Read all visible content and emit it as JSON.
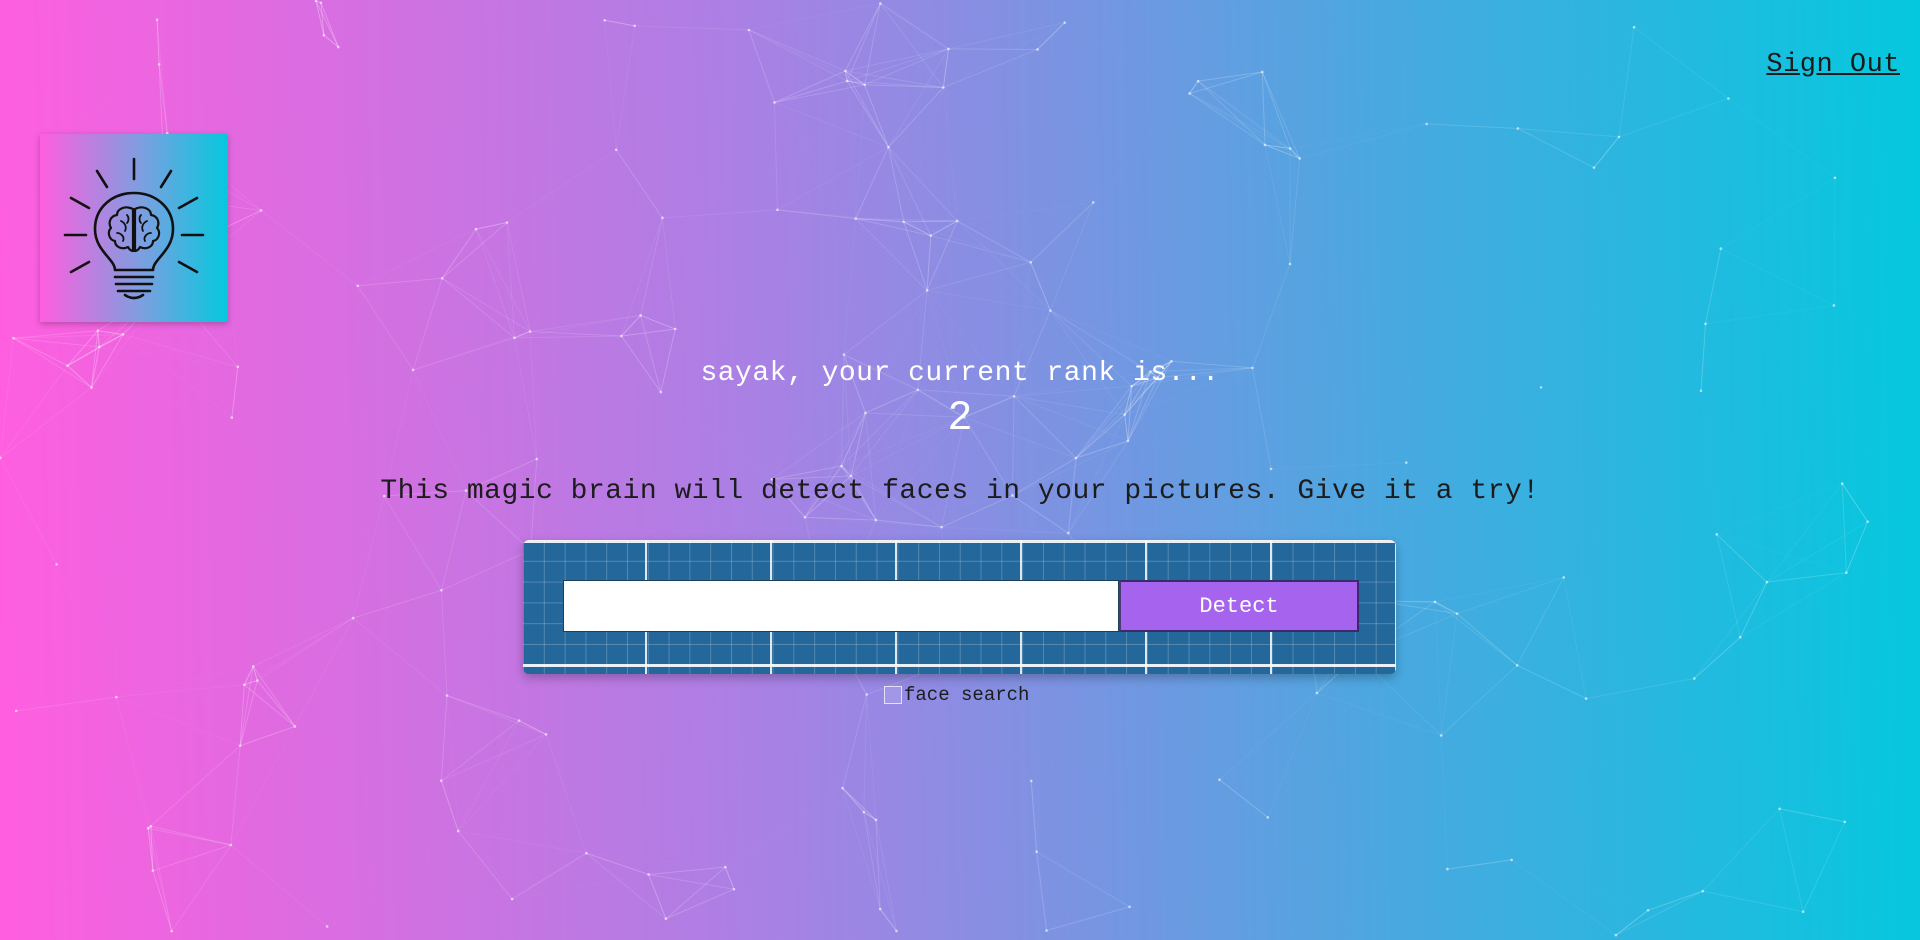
{
  "nav": {
    "signout_label": "Sign Out"
  },
  "logo": {
    "icon": "brain-lightbulb-icon"
  },
  "rank": {
    "message": "sayak, your current rank is...",
    "value": "2"
  },
  "intro": {
    "text": "This magic brain will detect faces in your pictures. Give it a try!"
  },
  "image_form": {
    "url_value": "",
    "placeholder": "",
    "detect_label": "Detect"
  },
  "face_search": {
    "label": "face search",
    "checked": false
  },
  "colors": {
    "gradient_start": "#ff5edf",
    "gradient_end": "#04c8de",
    "panel": "#23679b",
    "detect_button": "#a563ee"
  }
}
